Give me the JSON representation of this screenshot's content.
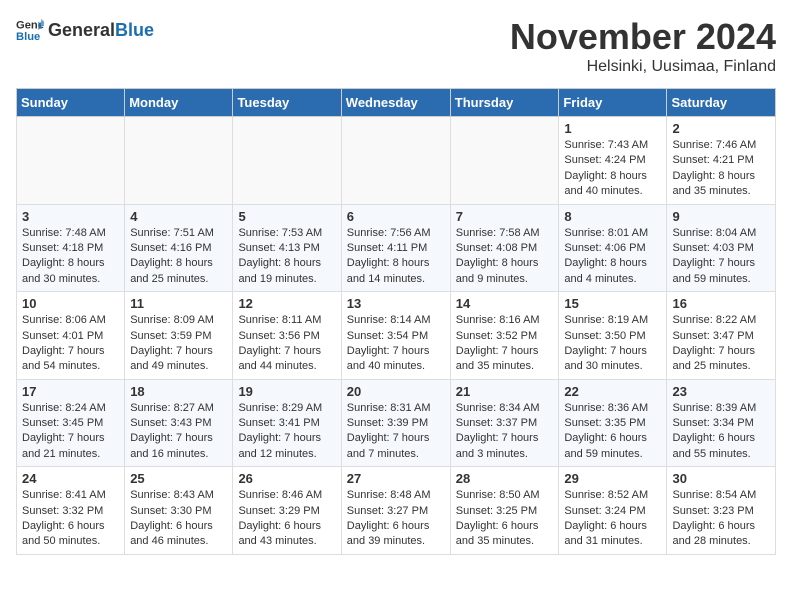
{
  "header": {
    "logo_general": "General",
    "logo_blue": "Blue",
    "month_title": "November 2024",
    "location": "Helsinki, Uusimaa, Finland"
  },
  "weekdays": [
    "Sunday",
    "Monday",
    "Tuesday",
    "Wednesday",
    "Thursday",
    "Friday",
    "Saturday"
  ],
  "weeks": [
    [
      {
        "day": "",
        "sunrise": "",
        "sunset": "",
        "daylight": ""
      },
      {
        "day": "",
        "sunrise": "",
        "sunset": "",
        "daylight": ""
      },
      {
        "day": "",
        "sunrise": "",
        "sunset": "",
        "daylight": ""
      },
      {
        "day": "",
        "sunrise": "",
        "sunset": "",
        "daylight": ""
      },
      {
        "day": "",
        "sunrise": "",
        "sunset": "",
        "daylight": ""
      },
      {
        "day": "1",
        "sunrise": "Sunrise: 7:43 AM",
        "sunset": "Sunset: 4:24 PM",
        "daylight": "Daylight: 8 hours and 40 minutes."
      },
      {
        "day": "2",
        "sunrise": "Sunrise: 7:46 AM",
        "sunset": "Sunset: 4:21 PM",
        "daylight": "Daylight: 8 hours and 35 minutes."
      }
    ],
    [
      {
        "day": "3",
        "sunrise": "Sunrise: 7:48 AM",
        "sunset": "Sunset: 4:18 PM",
        "daylight": "Daylight: 8 hours and 30 minutes."
      },
      {
        "day": "4",
        "sunrise": "Sunrise: 7:51 AM",
        "sunset": "Sunset: 4:16 PM",
        "daylight": "Daylight: 8 hours and 25 minutes."
      },
      {
        "day": "5",
        "sunrise": "Sunrise: 7:53 AM",
        "sunset": "Sunset: 4:13 PM",
        "daylight": "Daylight: 8 hours and 19 minutes."
      },
      {
        "day": "6",
        "sunrise": "Sunrise: 7:56 AM",
        "sunset": "Sunset: 4:11 PM",
        "daylight": "Daylight: 8 hours and 14 minutes."
      },
      {
        "day": "7",
        "sunrise": "Sunrise: 7:58 AM",
        "sunset": "Sunset: 4:08 PM",
        "daylight": "Daylight: 8 hours and 9 minutes."
      },
      {
        "day": "8",
        "sunrise": "Sunrise: 8:01 AM",
        "sunset": "Sunset: 4:06 PM",
        "daylight": "Daylight: 8 hours and 4 minutes."
      },
      {
        "day": "9",
        "sunrise": "Sunrise: 8:04 AM",
        "sunset": "Sunset: 4:03 PM",
        "daylight": "Daylight: 7 hours and 59 minutes."
      }
    ],
    [
      {
        "day": "10",
        "sunrise": "Sunrise: 8:06 AM",
        "sunset": "Sunset: 4:01 PM",
        "daylight": "Daylight: 7 hours and 54 minutes."
      },
      {
        "day": "11",
        "sunrise": "Sunrise: 8:09 AM",
        "sunset": "Sunset: 3:59 PM",
        "daylight": "Daylight: 7 hours and 49 minutes."
      },
      {
        "day": "12",
        "sunrise": "Sunrise: 8:11 AM",
        "sunset": "Sunset: 3:56 PM",
        "daylight": "Daylight: 7 hours and 44 minutes."
      },
      {
        "day": "13",
        "sunrise": "Sunrise: 8:14 AM",
        "sunset": "Sunset: 3:54 PM",
        "daylight": "Daylight: 7 hours and 40 minutes."
      },
      {
        "day": "14",
        "sunrise": "Sunrise: 8:16 AM",
        "sunset": "Sunset: 3:52 PM",
        "daylight": "Daylight: 7 hours and 35 minutes."
      },
      {
        "day": "15",
        "sunrise": "Sunrise: 8:19 AM",
        "sunset": "Sunset: 3:50 PM",
        "daylight": "Daylight: 7 hours and 30 minutes."
      },
      {
        "day": "16",
        "sunrise": "Sunrise: 8:22 AM",
        "sunset": "Sunset: 3:47 PM",
        "daylight": "Daylight: 7 hours and 25 minutes."
      }
    ],
    [
      {
        "day": "17",
        "sunrise": "Sunrise: 8:24 AM",
        "sunset": "Sunset: 3:45 PM",
        "daylight": "Daylight: 7 hours and 21 minutes."
      },
      {
        "day": "18",
        "sunrise": "Sunrise: 8:27 AM",
        "sunset": "Sunset: 3:43 PM",
        "daylight": "Daylight: 7 hours and 16 minutes."
      },
      {
        "day": "19",
        "sunrise": "Sunrise: 8:29 AM",
        "sunset": "Sunset: 3:41 PM",
        "daylight": "Daylight: 7 hours and 12 minutes."
      },
      {
        "day": "20",
        "sunrise": "Sunrise: 8:31 AM",
        "sunset": "Sunset: 3:39 PM",
        "daylight": "Daylight: 7 hours and 7 minutes."
      },
      {
        "day": "21",
        "sunrise": "Sunrise: 8:34 AM",
        "sunset": "Sunset: 3:37 PM",
        "daylight": "Daylight: 7 hours and 3 minutes."
      },
      {
        "day": "22",
        "sunrise": "Sunrise: 8:36 AM",
        "sunset": "Sunset: 3:35 PM",
        "daylight": "Daylight: 6 hours and 59 minutes."
      },
      {
        "day": "23",
        "sunrise": "Sunrise: 8:39 AM",
        "sunset": "Sunset: 3:34 PM",
        "daylight": "Daylight: 6 hours and 55 minutes."
      }
    ],
    [
      {
        "day": "24",
        "sunrise": "Sunrise: 8:41 AM",
        "sunset": "Sunset: 3:32 PM",
        "daylight": "Daylight: 6 hours and 50 minutes."
      },
      {
        "day": "25",
        "sunrise": "Sunrise: 8:43 AM",
        "sunset": "Sunset: 3:30 PM",
        "daylight": "Daylight: 6 hours and 46 minutes."
      },
      {
        "day": "26",
        "sunrise": "Sunrise: 8:46 AM",
        "sunset": "Sunset: 3:29 PM",
        "daylight": "Daylight: 6 hours and 43 minutes."
      },
      {
        "day": "27",
        "sunrise": "Sunrise: 8:48 AM",
        "sunset": "Sunset: 3:27 PM",
        "daylight": "Daylight: 6 hours and 39 minutes."
      },
      {
        "day": "28",
        "sunrise": "Sunrise: 8:50 AM",
        "sunset": "Sunset: 3:25 PM",
        "daylight": "Daylight: 6 hours and 35 minutes."
      },
      {
        "day": "29",
        "sunrise": "Sunrise: 8:52 AM",
        "sunset": "Sunset: 3:24 PM",
        "daylight": "Daylight: 6 hours and 31 minutes."
      },
      {
        "day": "30",
        "sunrise": "Sunrise: 8:54 AM",
        "sunset": "Sunset: 3:23 PM",
        "daylight": "Daylight: 6 hours and 28 minutes."
      }
    ]
  ]
}
